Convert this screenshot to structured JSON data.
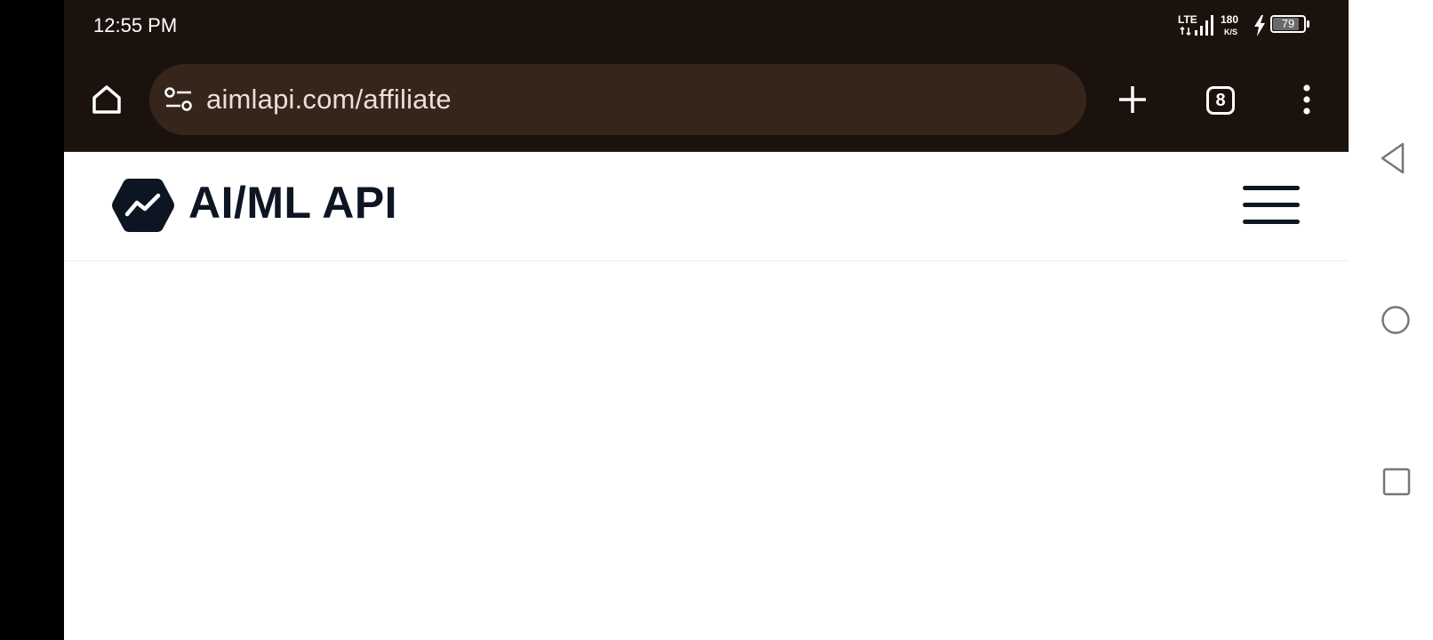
{
  "status_bar": {
    "time": "12:55 PM",
    "network_type": "LTE",
    "data_rate_value": "180",
    "data_rate_unit": "K/S",
    "battery_level": "79"
  },
  "browser": {
    "url": "aimlapi.com/affiliate",
    "tab_count": "8",
    "icons": [
      "home-icon",
      "site-settings-icon",
      "new-tab-icon",
      "tab-switcher-icon",
      "more-options-icon"
    ]
  },
  "site": {
    "brand_name": "AI/ML API",
    "icons": [
      "logo-icon",
      "hamburger-menu-icon"
    ]
  },
  "system_nav": {
    "icons": [
      "back-icon",
      "home-circle-icon",
      "recents-icon"
    ]
  },
  "colors": {
    "chrome_bg": "#1c120d",
    "url_bar_bg": "#36251a",
    "brand_text": "#0e1522"
  }
}
